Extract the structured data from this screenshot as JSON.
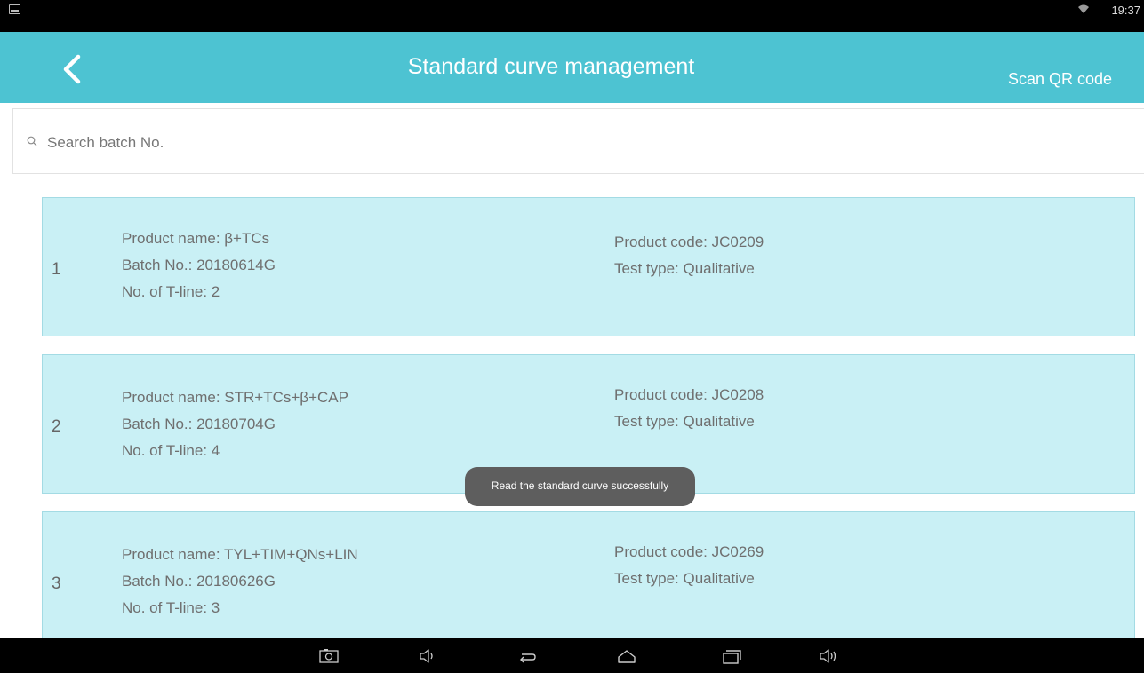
{
  "status_bar": {
    "time": "19:37",
    "icons": [
      "screenshot-icon",
      "wifi-icon"
    ]
  },
  "app_bar": {
    "title": "Standard curve management",
    "back_icon": "back-arrow-icon",
    "scan_label": "Scan QR code"
  },
  "search": {
    "placeholder": "Search batch No.",
    "value": "",
    "icon": "search-icon"
  },
  "curves": [
    {
      "index": "1",
      "product_name": "Product name: β+TCs",
      "batch_no": "Batch No.: 20180614G",
      "t_lines": "No. of T-line: 2",
      "product_code": "Product code: JC0209",
      "test_type": "Test type: Qualitative"
    },
    {
      "index": "2",
      "product_name": "Product name: STR+TCs+β+CAP",
      "batch_no": "Batch No.: 20180704G",
      "t_lines": "No. of T-line: 4",
      "product_code": "Product code: JC0208",
      "test_type": "Test type: Qualitative"
    },
    {
      "index": "3",
      "product_name": "Product name: TYL+TIM+QNs+LIN",
      "batch_no": "Batch No.: 20180626G",
      "t_lines": "No. of T-line: 3",
      "product_code": "Product code: JC0269",
      "test_type": "Test type: Qualitative"
    }
  ],
  "toast": {
    "message": "Read the standard curve successfully"
  },
  "nav_bar": {
    "icons": [
      "camera-icon",
      "volume-down-icon",
      "back-icon",
      "home-icon",
      "recent-apps-icon",
      "volume-up-icon"
    ]
  },
  "colors": {
    "app_bar": "#4dc3d2",
    "card_bg": "#c9f0f5",
    "card_border": "#a3dbe4",
    "toast_bg": "#5e5e5e"
  }
}
